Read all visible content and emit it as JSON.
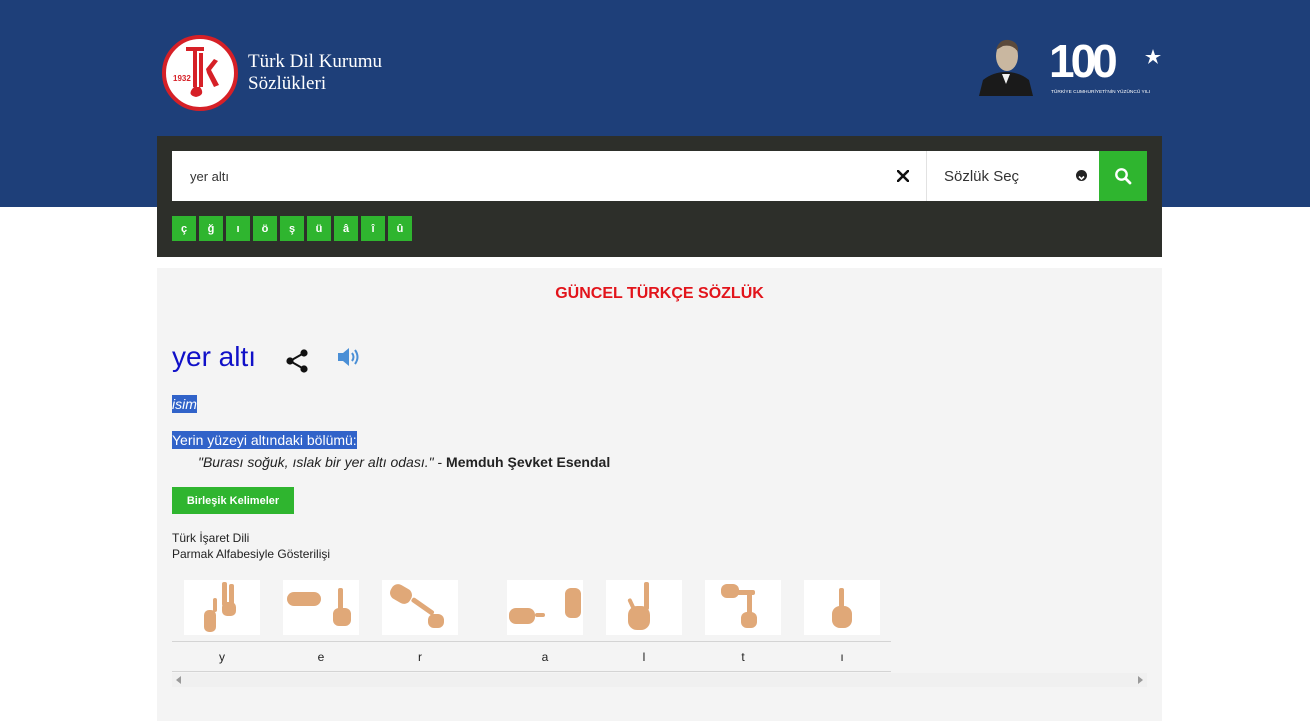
{
  "header": {
    "logo_year": "1932",
    "logo_letters": "TDK",
    "brand_line1": "Türk Dil Kurumu",
    "brand_line2": "Sözlükleri",
    "centennial_text": "100",
    "centennial_caption": "TÜRKİYE CUMHURİYETİ'NİN YÜZÜNCÜ YILI"
  },
  "search": {
    "query": "yer altı",
    "dictionary_select": "Sözlük Seç",
    "special_chars": [
      "ç",
      "ğ",
      "ı",
      "ö",
      "ş",
      "ü",
      "â",
      "î",
      "û"
    ]
  },
  "result": {
    "dictionary_title": "GÜNCEL TÜRKÇE SÖZLÜK",
    "word": "yer altı",
    "part_of_speech": "isim",
    "definition": "Yerin yüzeyi altındaki bölümü:",
    "example_quote": "\"Burası soğuk, ıslak bir yer altı odası.\"",
    "example_sep": " - ",
    "example_author": "Memduh Şevket Esendal",
    "compound_button": "Birleşik Kelimeler",
    "sign_title": "Türk İşaret Dili",
    "sign_subtitle": "Parmak Alfabesiyle Gösterilişi",
    "letters": [
      "y",
      "e",
      "r",
      "a",
      "l",
      "t",
      "ı"
    ]
  },
  "colors": {
    "header_bg": "#1e3f79",
    "accent_green": "#2fb52f",
    "title_red": "#e2141b",
    "word_blue": "#1010c8",
    "highlight": "#3163c9"
  }
}
